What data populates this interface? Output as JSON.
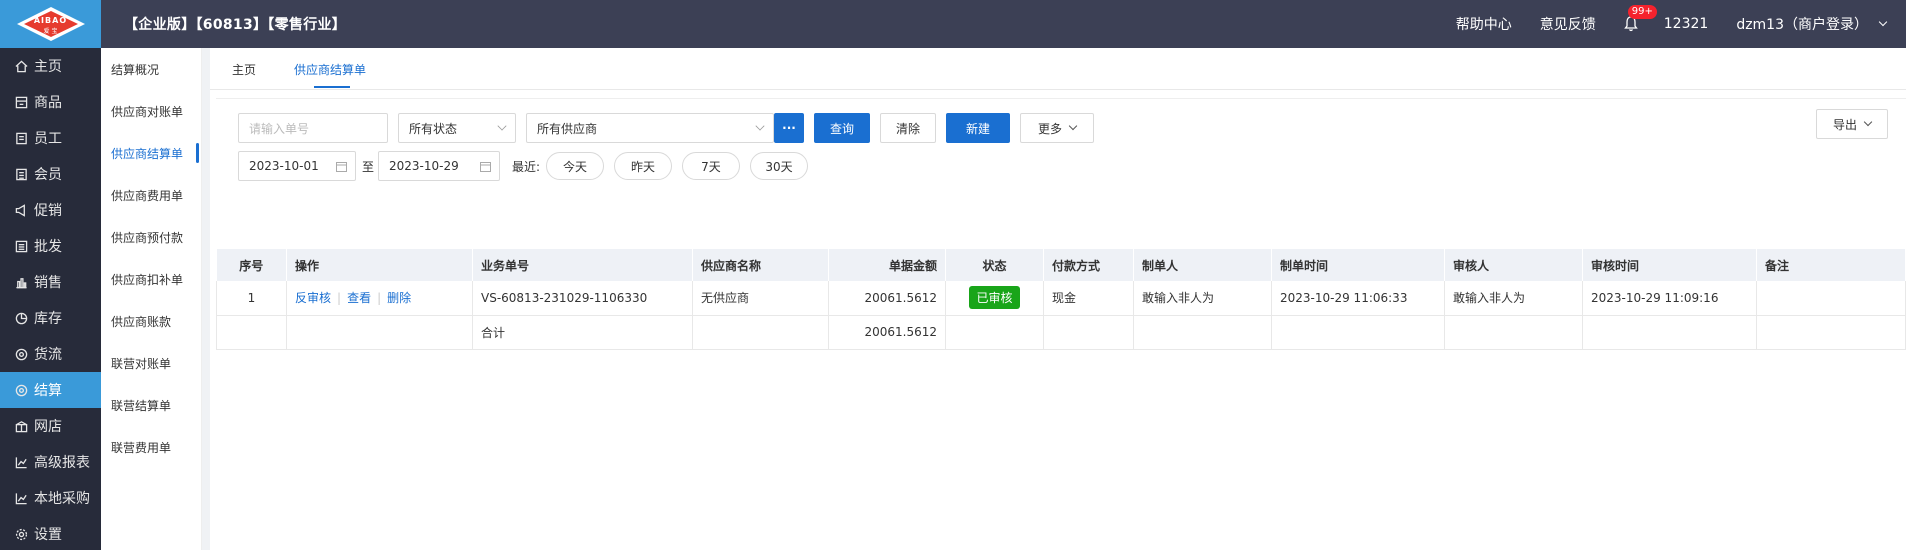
{
  "header": {
    "logo_text": "AIBAO",
    "logo_sub": "爱 宝",
    "title": "【企业版】【60813】【零售行业】",
    "help_label": "帮助中心",
    "feedback_label": "意见反馈",
    "notify_badge": "99+",
    "user_id": "12321",
    "user_name": "dzm13（商户登录）"
  },
  "nav": {
    "items": [
      {
        "label": "主页",
        "icon": "home-icon"
      },
      {
        "label": "商品",
        "icon": "goods-icon"
      },
      {
        "label": "员工",
        "icon": "staff-icon"
      },
      {
        "label": "会员",
        "icon": "member-icon"
      },
      {
        "label": "促销",
        "icon": "promo-icon"
      },
      {
        "label": "批发",
        "icon": "wholesale-icon"
      },
      {
        "label": "销售",
        "icon": "sales-icon"
      },
      {
        "label": "库存",
        "icon": "stock-icon"
      },
      {
        "label": "货流",
        "icon": "flow-icon"
      },
      {
        "label": "结算",
        "icon": "settle-icon"
      },
      {
        "label": "网店",
        "icon": "shop-icon"
      },
      {
        "label": "高级报表",
        "icon": "report-icon"
      },
      {
        "label": "本地采购",
        "icon": "purchase-icon"
      },
      {
        "label": "设置",
        "icon": "gear-icon"
      }
    ],
    "active_index": 9
  },
  "subnav": {
    "items": [
      "结算概况",
      "供应商对账单",
      "供应商结算单",
      "供应商费用单",
      "供应商预付款",
      "供应商扣补单",
      "供应商账款",
      "联营对账单",
      "联营结算单",
      "联营费用单"
    ],
    "active_index": 2
  },
  "tabs": [
    "主页",
    "供应商结算单"
  ],
  "filters": {
    "order_placeholder": "请输入单号",
    "status_value": "所有状态",
    "supplier_value": "所有供应商",
    "more_dots": "···",
    "query_label": "查询",
    "clear_label": "清除",
    "new_label": "新建",
    "more_label": "更多",
    "export_label": "导出",
    "date_from": "2023-10-01",
    "date_sep": "至",
    "date_to": "2023-10-29",
    "recent_label": "最近:",
    "quick_dates": [
      "今天",
      "昨天",
      "7天",
      "30天"
    ]
  },
  "table": {
    "headers": [
      "序号",
      "操作",
      "业务单号",
      "供应商名称",
      "单据金额",
      "状态",
      "付款方式",
      "制单人",
      "制单时间",
      "审核人",
      "审核时间",
      "备注"
    ],
    "rows": [
      {
        "index": "1",
        "ops": [
          "反审核",
          "查看",
          "删除"
        ],
        "order_no": "VS-60813-231029-1106330",
        "supplier": "无供应商",
        "amount": "20061.5612",
        "status": "已审核",
        "payment": "现金",
        "creator": "敢输入非人为",
        "created_at": "2023-10-29 11:06:33",
        "auditor": "敢输入非人为",
        "audited_at": "2023-10-29 11:09:16",
        "remark": ""
      }
    ],
    "total_label": "合计",
    "total_amount": "20061.5612"
  },
  "colors": {
    "topbar": "#3c4055",
    "nav": "#272b3a",
    "accent": "#3a9ad9",
    "primary": "#1a6fd1",
    "status_green": "#19a519"
  }
}
